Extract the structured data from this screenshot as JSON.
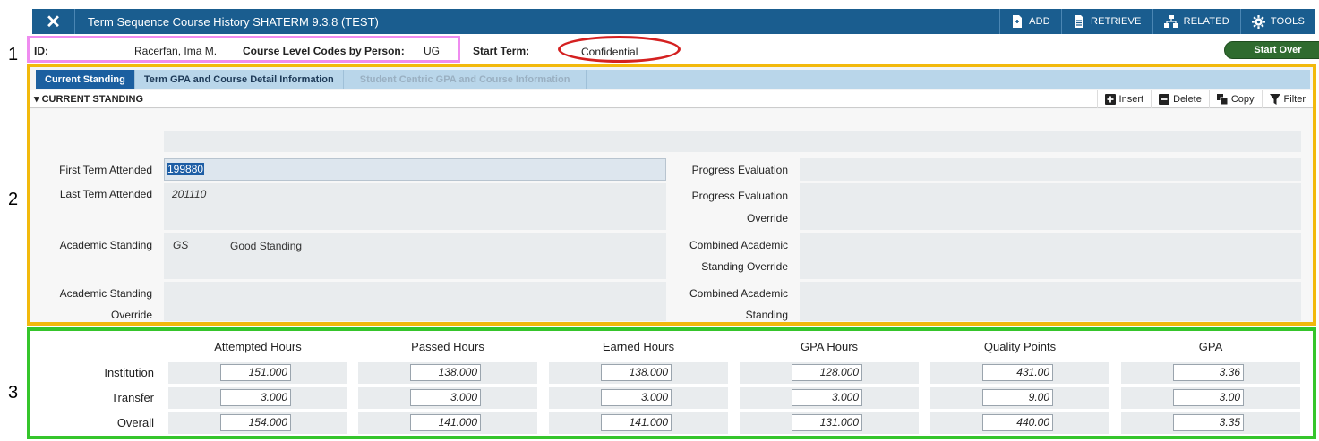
{
  "header": {
    "close_icon": "close-icon",
    "title": "Term Sequence Course History SHATERM 9.3.8 (TEST)",
    "buttons": [
      {
        "label": "ADD",
        "icon": "add-document-icon"
      },
      {
        "label": "RETRIEVE",
        "icon": "retrieve-document-icon"
      },
      {
        "label": "RELATED",
        "icon": "related-hierarchy-icon"
      },
      {
        "label": "TOOLS",
        "icon": "gear-icon"
      }
    ]
  },
  "annotations": [
    "1",
    "2",
    "3"
  ],
  "keyblock": {
    "id_label": "ID:",
    "id_value": "Racerfan, Ima M.",
    "course_level_label": "Course Level Codes by Person:",
    "course_level_value": "UG",
    "start_term_label": "Start Term:",
    "start_term_value": "Confidential",
    "start_over_label": "Start Over"
  },
  "tabs": [
    {
      "label": "Current Standing",
      "state": "active"
    },
    {
      "label": "Term GPA and Course Detail Information",
      "state": "enabled"
    },
    {
      "label": "Student Centric GPA and Course Information",
      "state": "disabled"
    }
  ],
  "section": {
    "title": "CURRENT STANDING",
    "actions": [
      {
        "label": "Insert",
        "icon": "plus-icon"
      },
      {
        "label": "Delete",
        "icon": "minus-icon"
      },
      {
        "label": "Copy",
        "icon": "copy-icon"
      },
      {
        "label": "Filter",
        "icon": "filter-icon"
      }
    ]
  },
  "standing": {
    "first_term_label": "First Term Attended",
    "first_term_value": "199880",
    "last_term_label": "Last Term Attended",
    "last_term_value": "201110",
    "academic_standing_label": "Academic Standing",
    "academic_standing_code": "GS",
    "academic_standing_desc": "Good Standing",
    "academic_override_label_1": "Academic Standing",
    "academic_override_label_2": "Override",
    "progress_eval_label": "Progress Evaluation",
    "progress_override_label_1": "Progress Evaluation",
    "progress_override_label_2": "Override",
    "combined_override_label_1": "Combined Academic",
    "combined_override_label_2": "Standing Override",
    "combined_label_1": "Combined Academic",
    "combined_label_2": "Standing"
  },
  "hours": {
    "columns": [
      "Attempted Hours",
      "Passed Hours",
      "Earned Hours",
      "GPA Hours",
      "Quality Points",
      "GPA"
    ],
    "rows": [
      {
        "label": "Institution",
        "values": [
          "151.000",
          "138.000",
          "138.000",
          "128.000",
          "431.00",
          "3.36"
        ]
      },
      {
        "label": "Transfer",
        "values": [
          "3.000",
          "3.000",
          "3.000",
          "3.000",
          "9.00",
          "3.00"
        ]
      },
      {
        "label": "Overall",
        "values": [
          "154.000",
          "141.000",
          "141.000",
          "131.000",
          "440.00",
          "3.35"
        ]
      }
    ]
  }
}
